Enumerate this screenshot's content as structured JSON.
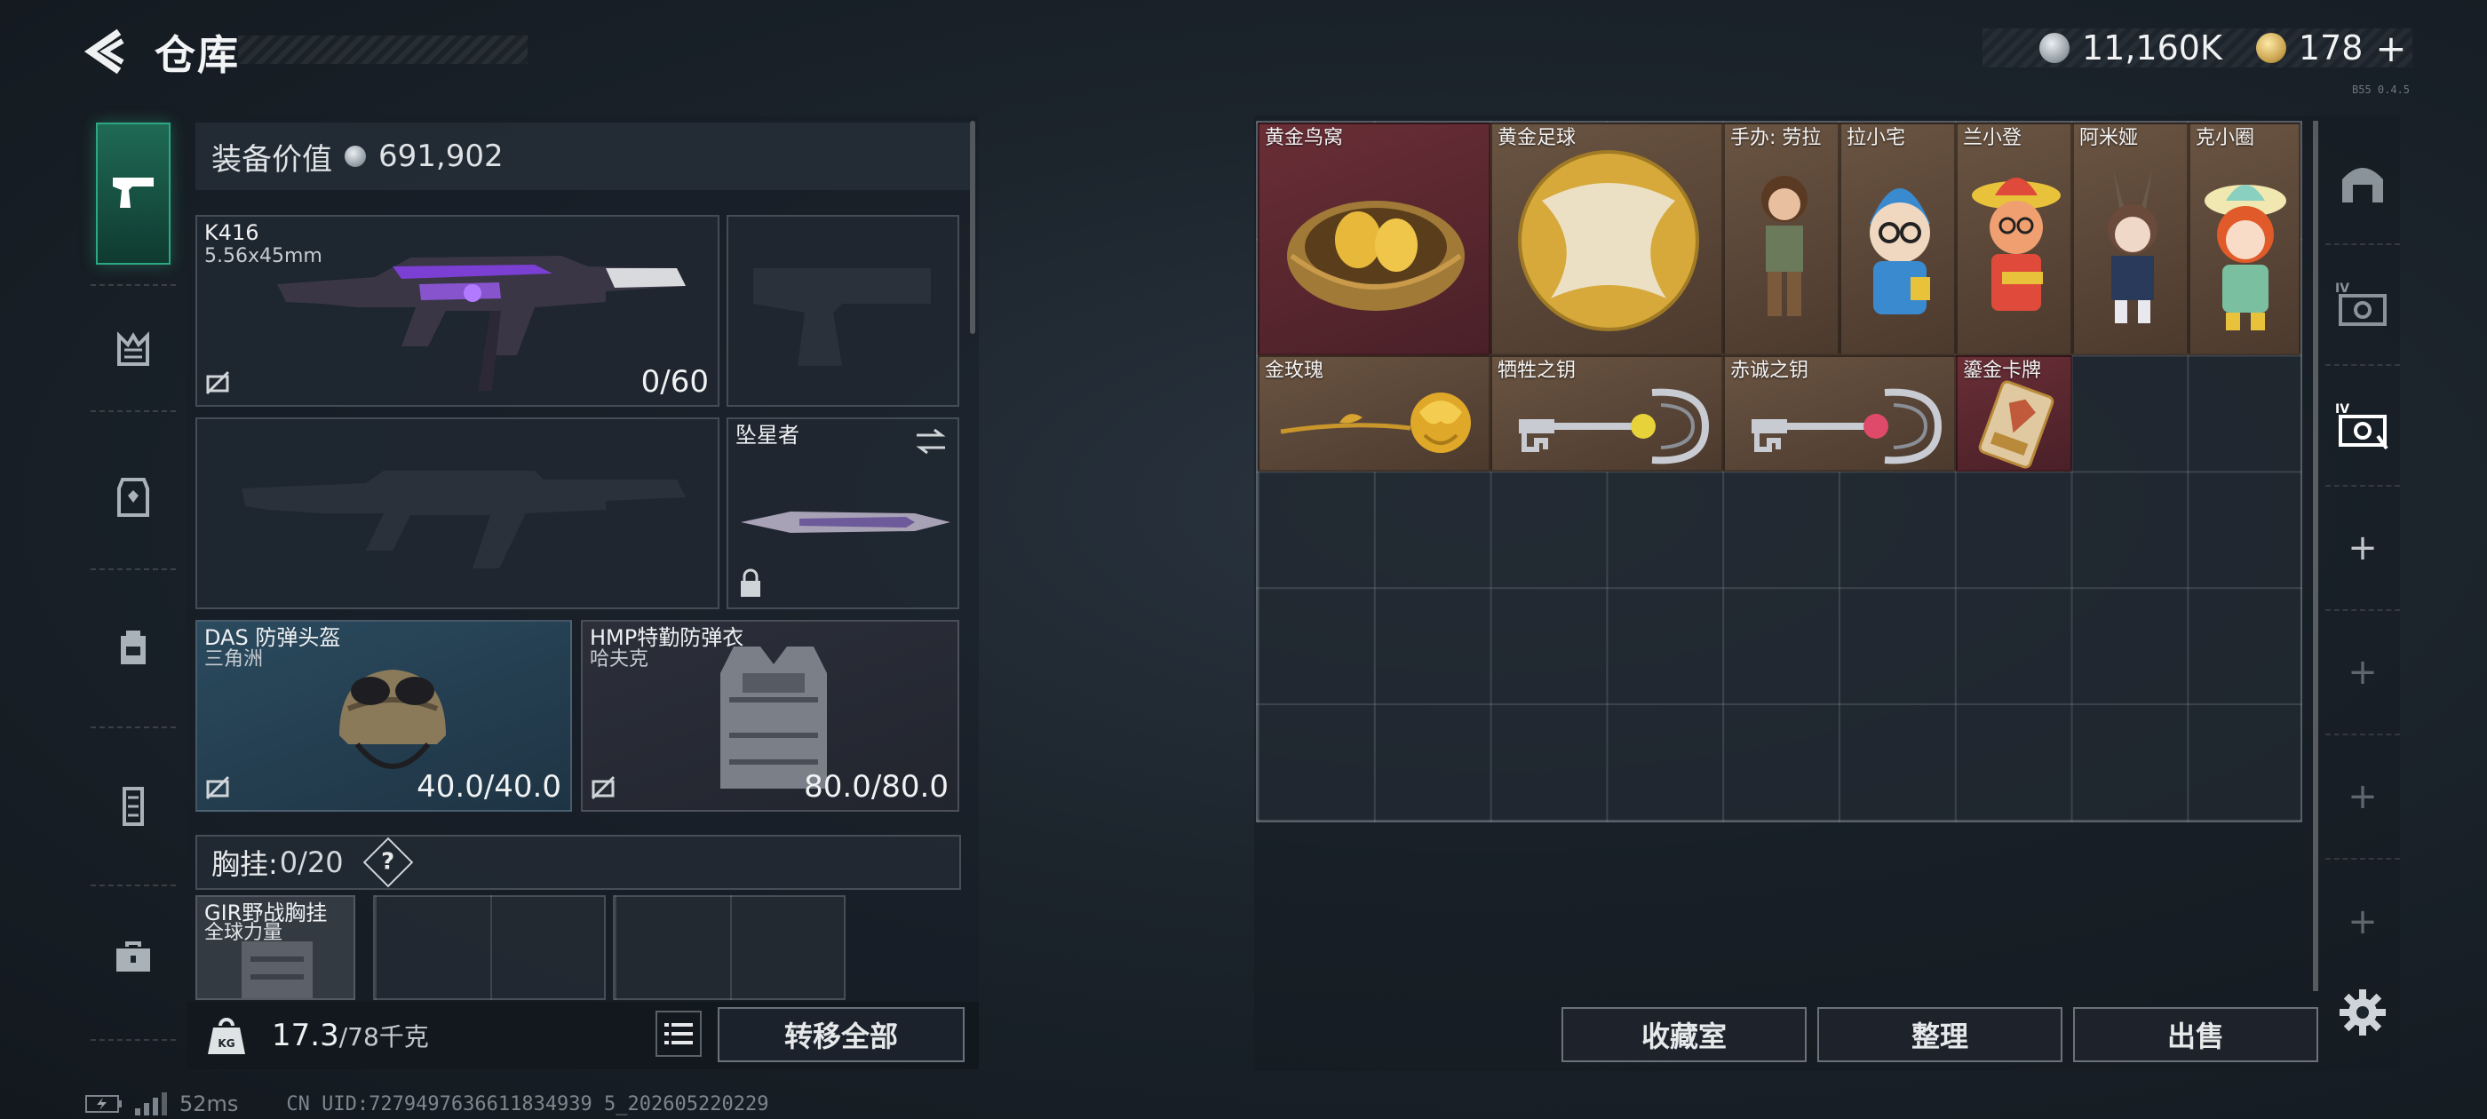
{
  "header": {
    "title": "仓库",
    "currency": [
      {
        "type": "silver",
        "amount": "11,160K"
      },
      {
        "type": "gold",
        "amount": "178"
      }
    ],
    "add_label": "+",
    "version_tag": "B55 0.4.5"
  },
  "left_rail": {
    "items": [
      {
        "name": "weapons",
        "icon": "pistol-icon",
        "active": true
      },
      {
        "name": "attachments",
        "icon": "crown-icon",
        "active": false
      },
      {
        "name": "armor",
        "icon": "vest-icon",
        "active": false
      },
      {
        "name": "helmet",
        "icon": "backpack-icon",
        "active": false
      },
      {
        "name": "chest-rig",
        "icon": "rig-icon",
        "active": false
      },
      {
        "name": "supplies",
        "icon": "toolbox-icon",
        "active": false
      }
    ]
  },
  "equipment": {
    "value_label": "装备价值",
    "value": "691,902",
    "primary_weapon": {
      "name": "K416",
      "ammo": "5.56x45mm",
      "durability": "0/60"
    },
    "pistol": {
      "name": ""
    },
    "secondary_weapon": {
      "name": ""
    },
    "melee": {
      "name": "坠星者"
    },
    "helmet": {
      "name": "DAS 防弹头盔",
      "faction": "三角洲",
      "durability": "40.0/40.0"
    },
    "armor": {
      "name": "HMP特勤防弹衣",
      "faction": "哈夫克",
      "durability": "80.0/80.0"
    },
    "chest_rig": {
      "label": "胸挂:",
      "capacity": "0/20",
      "help": "?",
      "item_name": "GIR野战胸挂",
      "item_sub": "全球力量"
    },
    "weight": {
      "current": "17.3",
      "max": "/78千克"
    },
    "transfer_all": "转移全部"
  },
  "storage": {
    "items": [
      {
        "label": "黄金鸟窝",
        "style": "red",
        "icon": "golden-nest-icon"
      },
      {
        "label": "黄金足球",
        "style": "gold",
        "icon": "golden-football-icon"
      },
      {
        "label": "手办: 劳拉",
        "style": "gold",
        "icon": "figure-lara-icon"
      },
      {
        "label": "拉小宅",
        "style": "gold",
        "icon": "figure-laxiaozhai-icon"
      },
      {
        "label": "兰小登",
        "style": "gold",
        "icon": "figure-lanxiaodeng-icon"
      },
      {
        "label": "阿米娅",
        "style": "gold",
        "icon": "figure-amiya-icon"
      },
      {
        "label": "克小圈",
        "style": "gold",
        "icon": "figure-kexiaoquan-icon"
      },
      {
        "label": "金玫瑰",
        "style": "gold",
        "icon": "golden-rose-icon"
      },
      {
        "label": "牺牲之钥",
        "style": "gold",
        "icon": "sacrifice-key-icon"
      },
      {
        "label": "赤诚之钥",
        "style": "gold",
        "icon": "devotion-key-icon"
      },
      {
        "label": "鎏金卡牌",
        "style": "red",
        "icon": "gilded-card-icon"
      }
    ],
    "buttons": {
      "collection": "收藏室",
      "sort": "整理",
      "sell": "出售"
    }
  },
  "right_rail": {
    "items": [
      "home-icon",
      "storage-box-icon",
      "storage-box-active-icon",
      "add-icon",
      "add-icon",
      "add-icon",
      "add-icon"
    ]
  },
  "status": {
    "ping": "52ms",
    "uid": "CN UID:7279497636611834939 5_202605220229"
  },
  "colors": {
    "accent": "#2ea783",
    "gold_rarity": "#5a4636",
    "red_rarity": "#5c2830"
  }
}
